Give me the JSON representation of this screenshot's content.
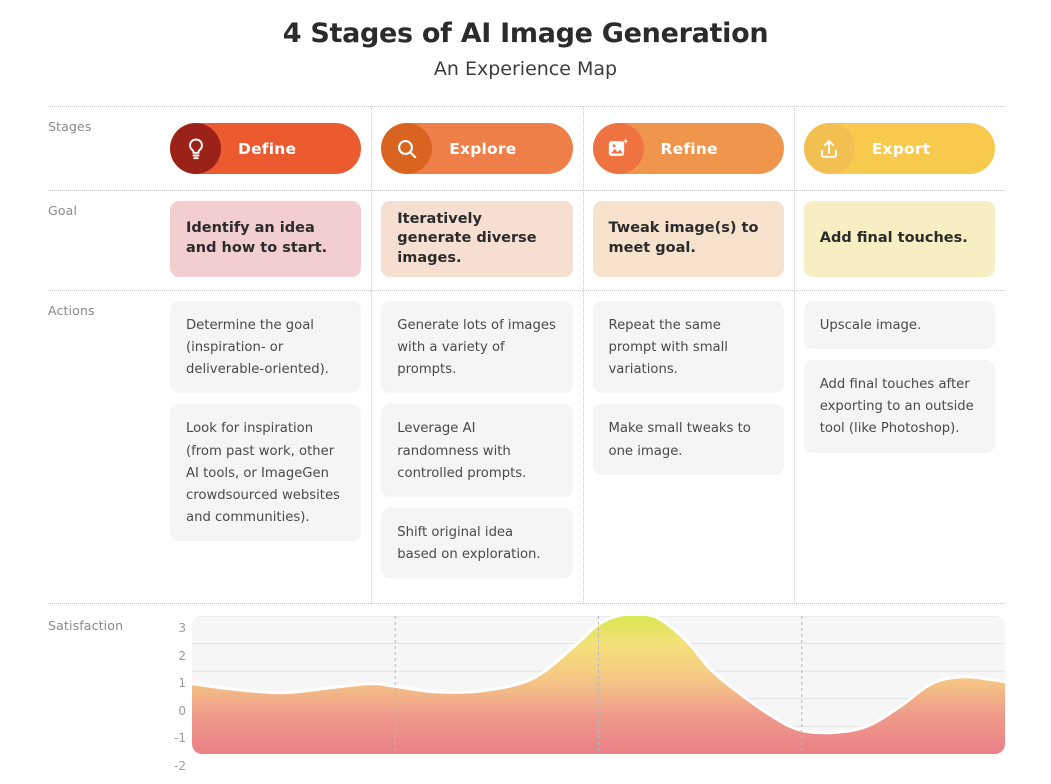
{
  "header": {
    "title": "4 Stages of AI Image Generation",
    "subtitle": "An Experience Map"
  },
  "rows": {
    "stages_label": "Stages",
    "goal_label": "Goal",
    "actions_label": "Actions",
    "satisfaction_label": "Satisfaction"
  },
  "stages": [
    {
      "name": "Define",
      "icon": "lightbulb-icon",
      "pill_color": "#ec5b30",
      "circle_color": "#9b2218"
    },
    {
      "name": "Explore",
      "icon": "search-icon",
      "pill_color": "#ef7f48",
      "circle_color": "#d9641f"
    },
    {
      "name": "Refine",
      "icon": "image-sparkle-icon",
      "pill_color": "#f0954c",
      "circle_color": "#ef7340"
    },
    {
      "name": "Export",
      "icon": "upload-icon",
      "pill_color": "#f7c94d",
      "circle_color": "#f2bf51"
    }
  ],
  "goals": [
    {
      "text": "Identify an idea and how to start.",
      "bg": "#f3ced0"
    },
    {
      "text": "Iteratively generate diverse images.",
      "bg": "#f6ded0"
    },
    {
      "text": "Tweak image(s) to meet goal.",
      "bg": "#f6e2cd"
    },
    {
      "text": "Add final touches.",
      "bg": "#f7eec2"
    }
  ],
  "actions": [
    [
      "Determine the goal (inspiration- or deliverable-oriented).",
      "Look for inspiration (from past work, other AI tools, or ImageGen crowdsourced websites and communities)."
    ],
    [
      "Generate lots of images with a variety of prompts.",
      "Leverage AI randomness with controlled prompts.",
      "Shift original idea based on exploration."
    ],
    [
      "Repeat the same prompt with small variations.",
      "Make small tweaks to one image."
    ],
    [
      "Upscale image.",
      "Add final touches after exporting to an outside tool (like Photoshop)."
    ]
  ],
  "chart_data": {
    "type": "area",
    "title": "Satisfaction",
    "xlabel": "",
    "ylabel": "Satisfaction",
    "ylim": [
      -2,
      3
    ],
    "yticks": [
      3,
      2,
      1,
      0,
      -1,
      -2
    ],
    "grid": true,
    "legend": "none",
    "stage_boundaries": [
      0,
      0.25,
      0.5,
      0.75,
      1.0
    ],
    "series": [
      {
        "name": "Satisfaction",
        "x": [
          0.0,
          0.05,
          0.11,
          0.17,
          0.22,
          0.25,
          0.3,
          0.36,
          0.42,
          0.47,
          0.5,
          0.53,
          0.56,
          0.58,
          0.61,
          0.64,
          0.68,
          0.72,
          0.75,
          0.79,
          0.83,
          0.87,
          0.91,
          0.95,
          1.0
        ],
        "y": [
          0.55,
          0.35,
          0.22,
          0.4,
          0.55,
          0.45,
          0.25,
          0.3,
          0.75,
          1.9,
          2.7,
          3.05,
          3.05,
          2.8,
          2.05,
          1.0,
          0.05,
          -0.75,
          -1.15,
          -1.22,
          -1.0,
          -0.3,
          0.55,
          0.8,
          0.62
        ]
      }
    ],
    "gradient_stops": [
      {
        "offset": "0%",
        "color": "#d8e84f"
      },
      {
        "offset": "22%",
        "color": "#f4e17a"
      },
      {
        "offset": "48%",
        "color": "#f5c584"
      },
      {
        "offset": "72%",
        "color": "#ef9b8b"
      },
      {
        "offset": "100%",
        "color": "#ea8086"
      }
    ]
  }
}
